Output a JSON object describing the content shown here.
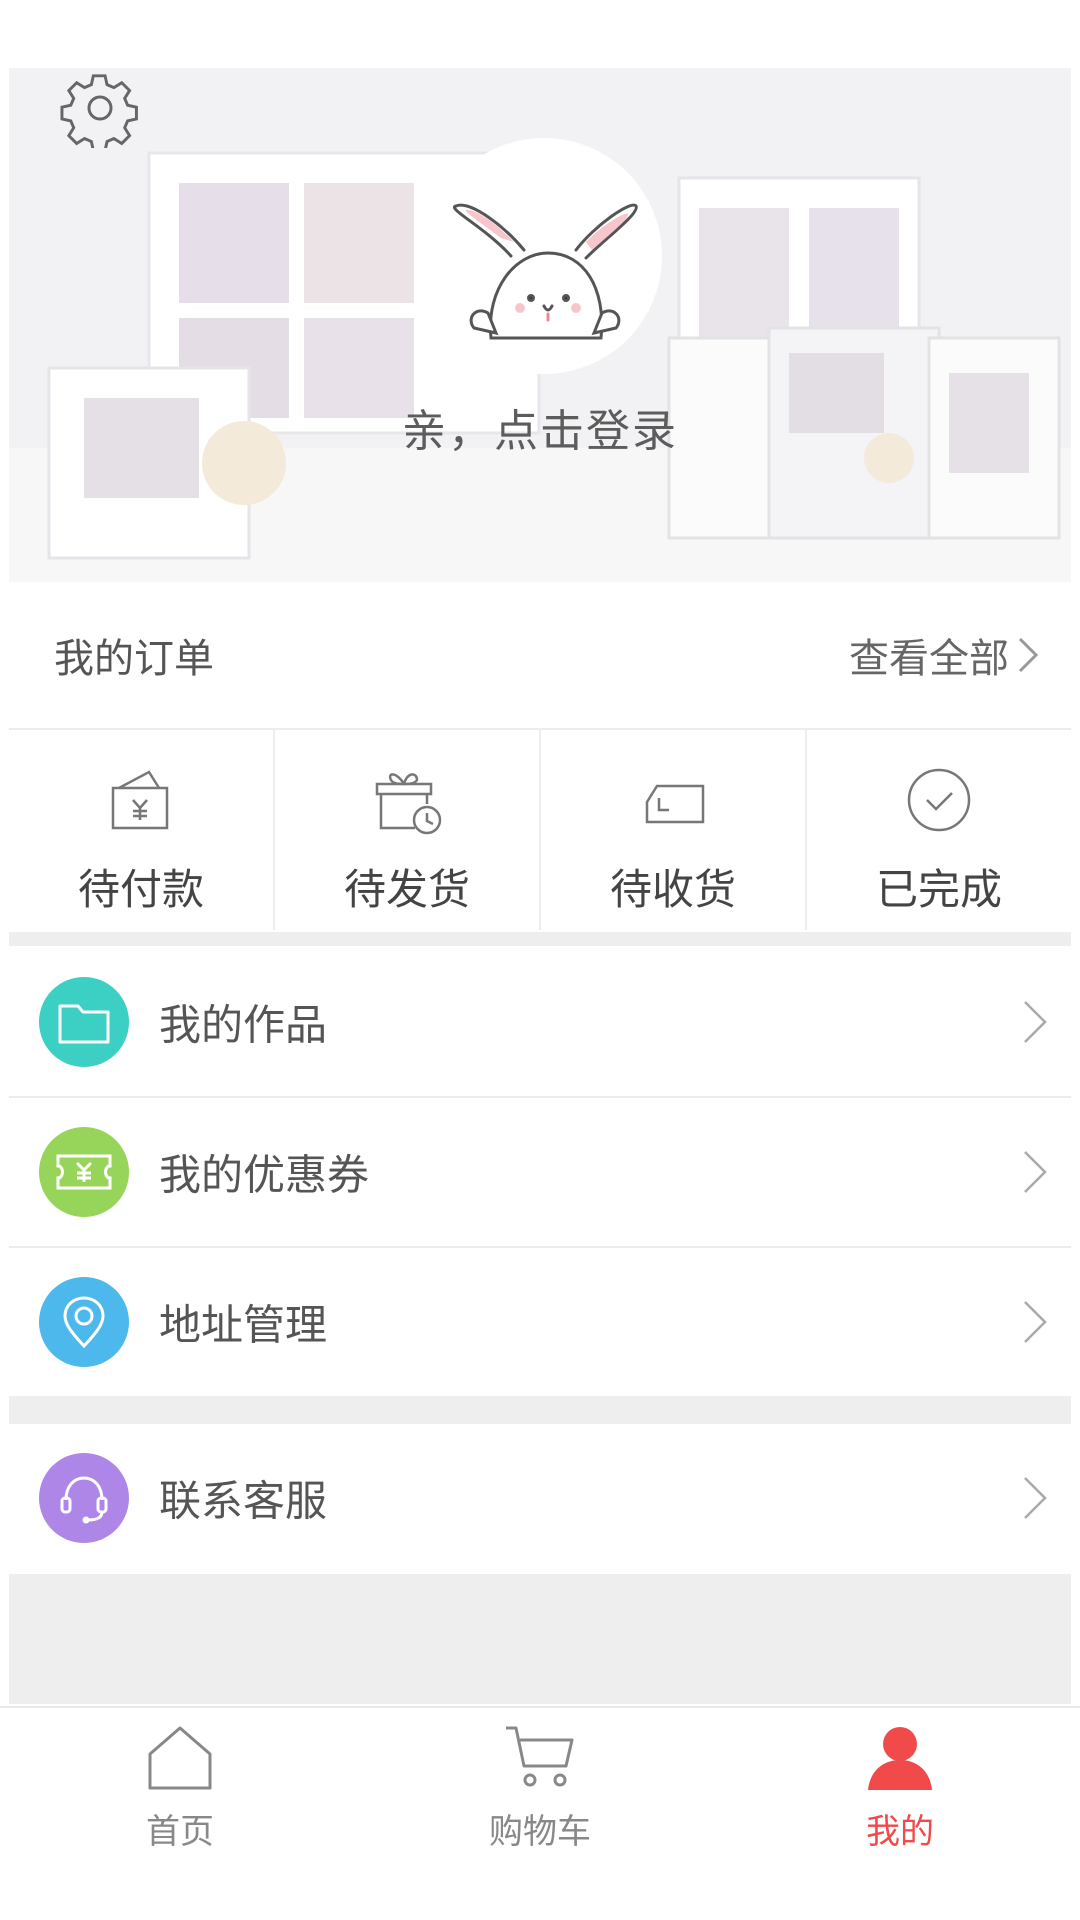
{
  "header": {
    "settings_icon": "gear-icon",
    "avatar_icon": "bunny-avatar",
    "login_text": "亲，点击登录"
  },
  "orders": {
    "title": "我的订单",
    "view_all": "查看全部",
    "statuses": [
      {
        "label": "待付款",
        "icon": "wallet-yen-icon"
      },
      {
        "label": "待发货",
        "icon": "gift-clock-icon"
      },
      {
        "label": "待收货",
        "icon": "truck-icon"
      },
      {
        "label": "已完成",
        "icon": "check-circle-icon"
      }
    ]
  },
  "menu": [
    {
      "label": "我的作品",
      "icon": "folder-icon",
      "color": "#3ccfc3"
    },
    {
      "label": "我的优惠券",
      "icon": "coupon-yen-icon",
      "color": "#97d45a"
    },
    {
      "label": "地址管理",
      "icon": "location-pin-icon",
      "color": "#4db8ec"
    },
    {
      "label": "联系客服",
      "icon": "headset-icon",
      "color": "#ad86e8"
    }
  ],
  "bottom_nav": [
    {
      "label": "首页",
      "icon": "home-icon"
    },
    {
      "label": "购物车",
      "icon": "cart-icon"
    },
    {
      "label": "我的",
      "icon": "user-icon",
      "active": true
    }
  ],
  "colors": {
    "accent": "#f04a4a",
    "divider": "#eeeeee"
  }
}
